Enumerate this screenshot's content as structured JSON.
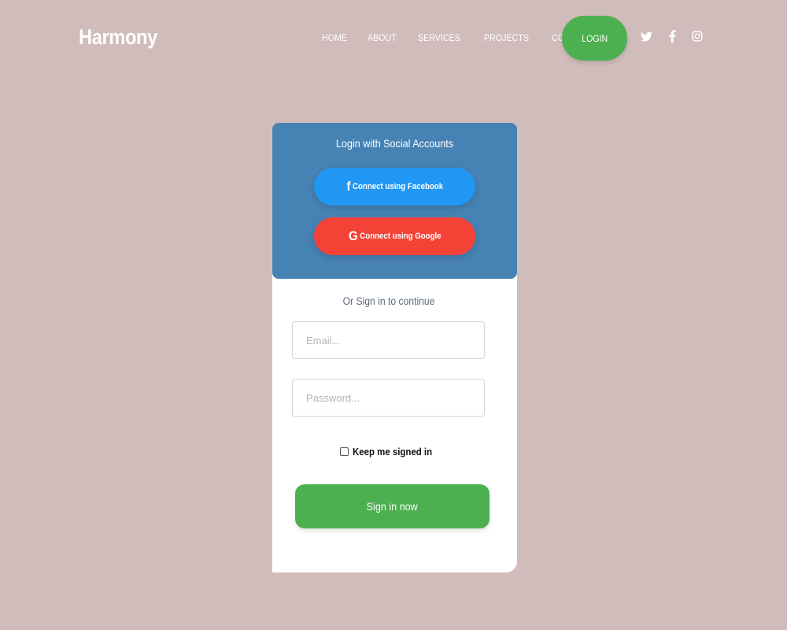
{
  "navbar": {
    "brand": "Harmony",
    "links": [
      "HOME",
      "ABOUT",
      "SERVICES",
      "PROJECTS",
      "CONTACT"
    ],
    "login_label": "LOGIN",
    "social_icons": [
      "twitter-icon",
      "facebook-icon",
      "instagram-icon"
    ]
  },
  "social_login": {
    "title": "Login with Social Accounts",
    "facebook": {
      "glyph": "f",
      "label": "Connect using Facebook",
      "color": "#2196f3"
    },
    "google": {
      "glyph": "G",
      "label": "Connect using Google",
      "color": "#f44336"
    }
  },
  "form": {
    "divider_text": "Or Sign in to continue",
    "email_placeholder": "Email...",
    "email_value": "",
    "password_placeholder": "Password...",
    "password_value": "",
    "remember_label": "Keep me signed in",
    "remember_checked": false,
    "submit_label": "Sign in now"
  },
  "colors": {
    "background": "#d0bdbb",
    "accent_green": "#4caf50",
    "header_blue": "#4682b4"
  }
}
